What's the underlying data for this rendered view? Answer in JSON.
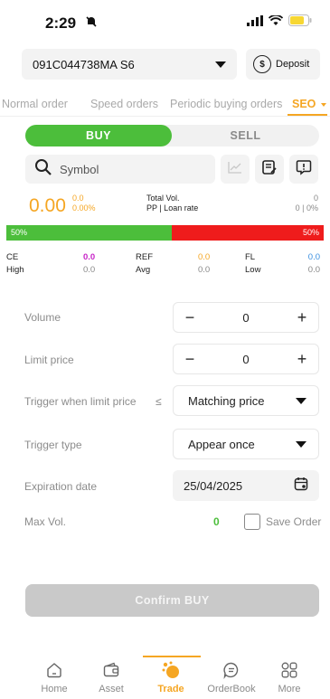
{
  "status_bar": {
    "time": "2:29"
  },
  "account": {
    "number": "091C044738MA S6",
    "deposit_label": "Deposit"
  },
  "order_tabs": [
    {
      "label": "Normal order",
      "active": false
    },
    {
      "label": "Speed orders",
      "active": false
    },
    {
      "label": "Periodic buying orders",
      "active": false
    },
    {
      "label": "SEO",
      "active": true
    }
  ],
  "side_toggle": {
    "buy": "BUY",
    "sell": "SELL",
    "selected": "BUY"
  },
  "symbol": {
    "placeholder": "Symbol"
  },
  "price": {
    "last": "0.00",
    "change": "0.0",
    "change_pct": "0.00%",
    "total_vol_label": "Total Vol.",
    "total_vol_value": "0",
    "pp_label": "PP | Loan rate",
    "pp_value": "0 | 0%"
  },
  "ratio": {
    "buy_pct": "50%",
    "sell_pct": "50%"
  },
  "stats": {
    "ce_label": "CE",
    "ce_value": "0.0",
    "ref_label": "REF",
    "ref_value": "0.0",
    "fl_label": "FL",
    "fl_value": "0.0",
    "high_label": "High",
    "high_value": "0.0",
    "avg_label": "Avg",
    "avg_value": "0.0",
    "low_label": "Low",
    "low_value": "0.0"
  },
  "form": {
    "volume_label": "Volume",
    "volume_value": "0",
    "limit_price_label": "Limit price",
    "limit_price_value": "0",
    "trigger_label": "Trigger when limit price",
    "trigger_operator": "≤",
    "trigger_value": "Matching price",
    "trigger_type_label": "Trigger type",
    "trigger_type_value": "Appear once",
    "expiration_label": "Expiration date",
    "expiration_value": "25/04/2025",
    "max_vol_label": "Max Vol.",
    "max_vol_value": "0",
    "save_order_label": "Save Order"
  },
  "confirm_label": "Confirm BUY",
  "bottom_nav": [
    {
      "label": "Home",
      "icon": "home-icon",
      "active": false
    },
    {
      "label": "Asset",
      "icon": "wallet-icon",
      "active": false
    },
    {
      "label": "Trade",
      "icon": "trade-icon",
      "active": true
    },
    {
      "label": "OrderBook",
      "icon": "orderbook-icon",
      "active": false
    },
    {
      "label": "More",
      "icon": "more-grid-icon",
      "active": false
    }
  ],
  "colors": {
    "accent": "#f5a623",
    "buy_green": "#4cbe3b",
    "sell_red": "#ef1c1c",
    "ce_purple": "#c724c7",
    "fl_blue": "#3a8fe0"
  }
}
